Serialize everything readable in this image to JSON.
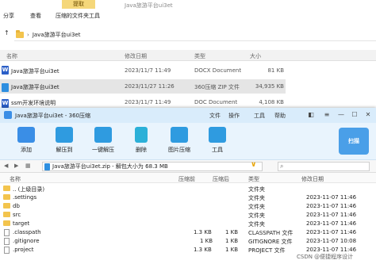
{
  "explorer": {
    "context_tab": "提取",
    "title": "Java旅游平台ui3et",
    "tabs": [
      "分享",
      "查看",
      "压缩的文件夹工具"
    ],
    "address": "Java旅游平台ui3et",
    "columns": [
      "名称",
      "修改日期",
      "类型",
      "大小"
    ],
    "files": [
      {
        "name": "Java旅游平台ui3et",
        "date": "2023/11/7 11:49",
        "type": "DOCX Document",
        "size": "81 KB",
        "icon": "docx-icon"
      },
      {
        "name": "Java旅游平台ui3et",
        "date": "2023/11/27 11:26",
        "type": "360压缩 ZIP 文件",
        "size": "34,935 KB",
        "icon": "zip-icon",
        "selected": true
      },
      {
        "name": "ssm开发环境说明",
        "date": "2023/11/7 11:49",
        "type": "DOC Document",
        "size": "4,108 KB",
        "icon": "doc-icon"
      }
    ]
  },
  "zip": {
    "title": "Java旅游平台ui3et - 360压缩",
    "menus": [
      "文件",
      "操作",
      "工具",
      "帮助"
    ],
    "toolbar": [
      {
        "label": "添加",
        "icon": "add-icon",
        "color": "#3a8ee6"
      },
      {
        "label": "解压到",
        "icon": "extract-to-icon",
        "color": "#2f9be0"
      },
      {
        "label": "一键解压",
        "icon": "one-click-extract-icon",
        "color": "#2f9be0"
      },
      {
        "label": "删除",
        "icon": "delete-icon",
        "color": "#2bb0d8"
      },
      {
        "label": "图片压缩",
        "icon": "image-compress-icon",
        "color": "#2f9be0"
      },
      {
        "label": "工具",
        "icon": "tools-icon",
        "color": "#2f9be0"
      }
    ],
    "scan_label": "扫描",
    "path_text": "Java旅游平台ui3et.zip - 解包大小为 68.3 MB",
    "columns": [
      "名称",
      "压缩前",
      "压缩后",
      "类型",
      "修改日期"
    ],
    "rows": [
      {
        "name": ".. (上级目录)",
        "before": "",
        "after": "",
        "type": "文件夹",
        "date": "",
        "folder": true
      },
      {
        "name": ".settings",
        "before": "",
        "after": "",
        "type": "文件夹",
        "date": "2023-11-07 11:46",
        "folder": true
      },
      {
        "name": "db",
        "before": "",
        "after": "",
        "type": "文件夹",
        "date": "2023-11-07 11:46",
        "folder": true
      },
      {
        "name": "src",
        "before": "",
        "after": "",
        "type": "文件夹",
        "date": "2023-11-07 11:46",
        "folder": true
      },
      {
        "name": "target",
        "before": "",
        "after": "",
        "type": "文件夹",
        "date": "2023-11-07 11:46",
        "folder": true
      },
      {
        "name": ".classpath",
        "before": "1.3 KB",
        "after": "1 KB",
        "type": "CLASSPATH 文件",
        "date": "2023-11-07 11:46",
        "folder": false
      },
      {
        "name": ".gitignore",
        "before": "1 KB",
        "after": "1 KB",
        "type": "GITIGNORE 文件",
        "date": "2023-11-07 10:08",
        "folder": false
      },
      {
        "name": ".project",
        "before": "1.3 KB",
        "after": "1 KB",
        "type": "PROJECT 文件",
        "date": "2023-11-07 11:46",
        "folder": false
      }
    ],
    "watermark": "CSDN @便捷程序设计"
  }
}
